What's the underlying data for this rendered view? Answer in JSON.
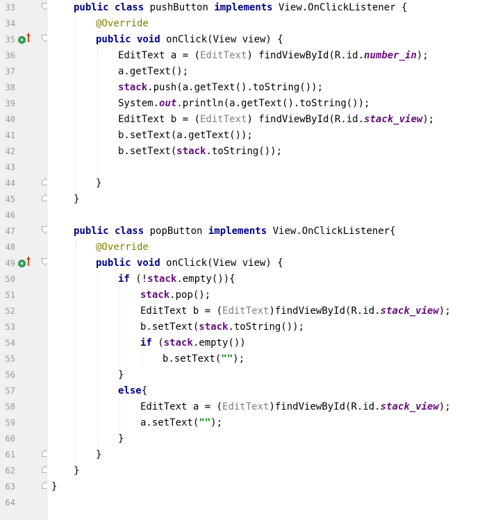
{
  "editor": {
    "line_numbers": [
      "33",
      "34",
      "35",
      "36",
      "37",
      "38",
      "39",
      "40",
      "41",
      "42",
      "43",
      "44",
      "45",
      "46",
      "47",
      "48",
      "49",
      "50",
      "51",
      "52",
      "53",
      "54",
      "55",
      "56",
      "57",
      "58",
      "59",
      "60",
      "61",
      "62",
      "63",
      "64"
    ],
    "colors": {
      "keyword": "#000080",
      "annotation": "#808000",
      "field": "#660e7a",
      "string": "#008000",
      "cast": "#808080",
      "gutter_bg": "#f0f0f0",
      "override_icon": "#3aa95a",
      "override_arrow": "#d04a2a"
    },
    "override_lines": [
      "35",
      "49"
    ]
  },
  "code": {
    "l33": {
      "kw1": "public class",
      "mid": " pushButton ",
      "kw2": "implements",
      "rest": " View.OnClickListener {"
    },
    "l34": {
      "ann": "@Override"
    },
    "l35": {
      "kw": "public void",
      "rest": " onClick(View view) {"
    },
    "l36": {
      "a": "EditText a = (",
      "cast": "EditText",
      "b": ") findViewById(R.id.",
      "fld": "number_in",
      "c": ");"
    },
    "l37": {
      "t": "a.getText();"
    },
    "l38": {
      "fld": "stack",
      "t": ".push(a.getText().toString());"
    },
    "l39": {
      "a": "System.",
      "fld": "out",
      "b": ".println(a.getText().toString());"
    },
    "l40": {
      "a": "EditText b = (",
      "cast": "EditText",
      "b": ") findViewById(R.id.",
      "fld": "stack_view",
      "c": ");"
    },
    "l41": {
      "t": "b.setText(a.getText());"
    },
    "l42": {
      "a": "b.setText(",
      "fld": "stack",
      "b": ".toString());"
    },
    "l44": {
      "t": "}"
    },
    "l45": {
      "t": "}"
    },
    "l47": {
      "kw1": "public class",
      "mid": " popButton ",
      "kw2": "implements",
      "rest": " View.OnClickListener{"
    },
    "l48": {
      "ann": "@Override"
    },
    "l49": {
      "kw": "public void",
      "rest": " onClick(View view) {"
    },
    "l50": {
      "kw": "if",
      "a": " (!",
      "fld": "stack",
      "b": ".empty()){"
    },
    "l51": {
      "fld": "stack",
      "t": ".pop();"
    },
    "l52": {
      "a": "EditText b = (",
      "cast": "EditText",
      "b": ")findViewById(R.id.",
      "fld": "stack_view",
      "c": ");"
    },
    "l53": {
      "a": "b.setText(",
      "fld": "stack",
      "b": ".toString());"
    },
    "l54": {
      "kw": "if",
      "a": " (",
      "fld": "stack",
      "b": ".empty())"
    },
    "l55": {
      "a": "b.setText(",
      "str": "\"\"",
      "b": ");"
    },
    "l56": {
      "t": "}"
    },
    "l57": {
      "kw": "else",
      "t": "{"
    },
    "l58": {
      "a": "EditText a = (",
      "cast": "EditText",
      "b": ")findViewById(R.id.",
      "fld": "stack_view",
      "c": ");"
    },
    "l59": {
      "a": "a.setText(",
      "str": "\"\"",
      "b": ");"
    },
    "l60": {
      "t": "}"
    },
    "l61": {
      "t": "}"
    },
    "l62": {
      "t": "}"
    },
    "l63": {
      "t": "}"
    }
  }
}
